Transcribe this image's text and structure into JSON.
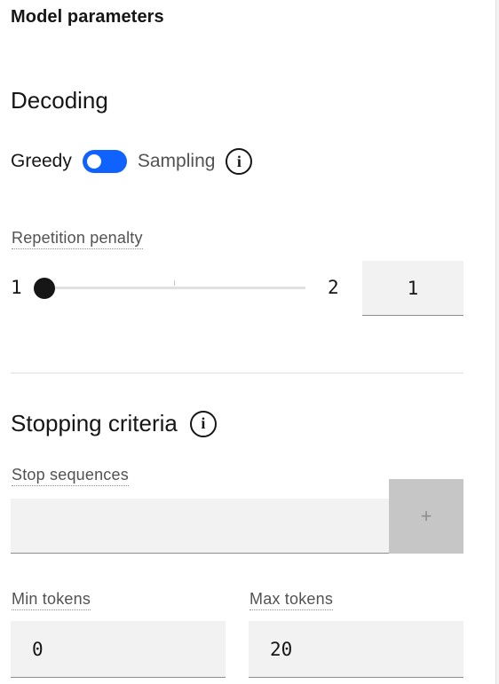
{
  "panel": {
    "title": "Model parameters"
  },
  "decoding": {
    "title": "Decoding",
    "left_option": "Greedy",
    "right_option": "Sampling",
    "toggle_color": "#0f62fe",
    "info_icon": "info-icon"
  },
  "repetition_penalty": {
    "label": "Repetition penalty",
    "min_label": "1",
    "max_label": "2",
    "value": "1"
  },
  "stopping": {
    "title": "Stopping criteria",
    "info_icon": "info-icon",
    "stop_sequences_label": "Stop sequences",
    "add_icon": "plus-icon",
    "add_label": "+",
    "min_tokens_label": "Min tokens",
    "min_tokens_value": "0",
    "max_tokens_label": "Max tokens",
    "max_tokens_value": "20"
  }
}
